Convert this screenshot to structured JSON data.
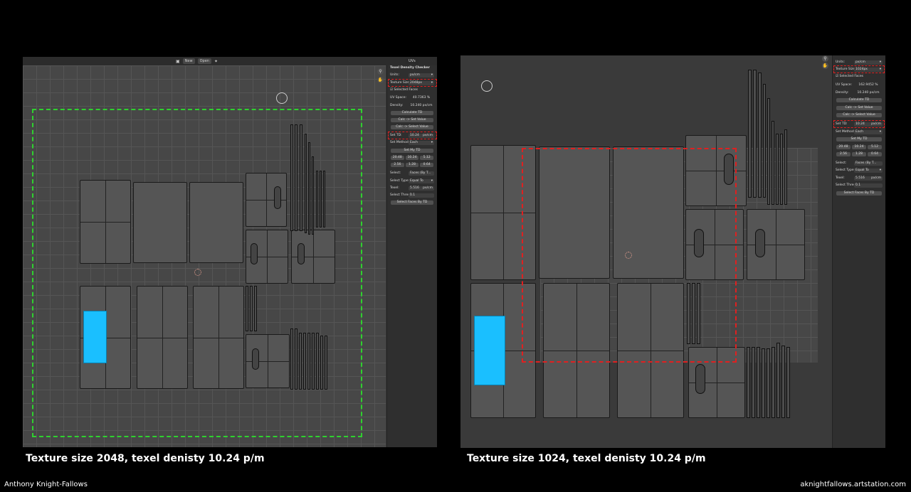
{
  "captions": {
    "left": "Texture size 2048, texel denisty 10.24 p/m",
    "right": "Texture size 1024, texel denisty 10.24 p/m"
  },
  "footer": {
    "author": "Anthony Knight-Fallows",
    "site": "aknightfallows.artstation.com"
  },
  "toolbar": {
    "new_label": "New",
    "open_label": "Open",
    "editor_label": "UVs"
  },
  "panel_left": {
    "title": "Texel Density Checker",
    "units_label": "Units:",
    "units_value": "px/cm",
    "texture_size_label": "Texture Size:",
    "texture_size_value": "2048px",
    "selected_faces": "Selected Faces",
    "uv_space_label": "UV Space:",
    "uv_space_value": "40.7363 %",
    "density_label": "Density:",
    "density_value": "10.240 px/cm",
    "calculate_label": "Calculate TD",
    "calc_set_label": "Calc -> Set Value",
    "calc_select_label": "Calc -> Select Value",
    "set_td_label": "Set TD:",
    "set_td_value": "10.24",
    "set_td_unit": "px/cm",
    "set_method_label": "Set Method:",
    "set_method_value": "Each",
    "set_my_td_label": "Set My TD",
    "presets_row1": [
      "20.48",
      "10.24",
      "5.12"
    ],
    "presets_row2": [
      "2.56",
      "1.28",
      "0.64"
    ],
    "select_label": "Select:",
    "select_value": "Faces (By T...",
    "select_type_label": "Select Type:",
    "select_type_value": "Equal To",
    "texel_label": "Texel:",
    "texel_value": "5.516",
    "texel_unit": "px/cm",
    "threshold_label": "Select Thresho...",
    "threshold_value": "0.1",
    "select_faces_label": "Select Faces By TD"
  },
  "panel_right": {
    "units_label": "Units:",
    "units_value": "px/cm",
    "texture_size_label": "Texture Size:",
    "texture_size_value": "1024px",
    "selected_faces": "Selected Faces",
    "uv_space_label": "UV Space:",
    "uv_space_value": "162.9452 %",
    "density_label": "Density:",
    "density_value": "10.240 px/cm",
    "calculate_label": "Calculate TD",
    "calc_set_label": "Calc -> Set Value",
    "calc_select_label": "Calc -> Select Value",
    "set_td_label": "Set TD:",
    "set_td_value": "10.24",
    "set_td_unit": "px/cm",
    "set_method_label": "Set Method:",
    "set_method_value": "Each",
    "set_my_td_label": "Set My TD",
    "presets_row1": [
      "20.48",
      "10.24",
      "5.12"
    ],
    "presets_row2": [
      "2.56",
      "1.28",
      "0.64"
    ],
    "select_label": "Select:",
    "select_value": "Faces (By T...",
    "select_type_label": "Select Type:",
    "select_type_value": "Equal To",
    "texel_label": "Texel:",
    "texel_value": "5.516",
    "texel_unit": "px/cm",
    "threshold_label": "Select Thresho...",
    "threshold_value": "0.1",
    "select_faces_label": "Select Faces By TD"
  },
  "colors": {
    "selection": "#1abfff",
    "bounds_2048": "#2fd12f",
    "bounds_1024": "#e02020",
    "highlight": "#e02020"
  }
}
